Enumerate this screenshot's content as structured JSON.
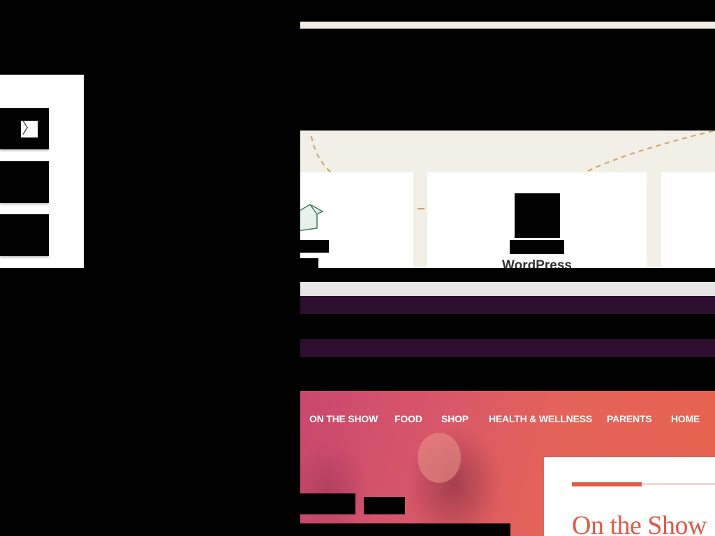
{
  "left_panel": {
    "chevron_glyph": "〉"
  },
  "cards": {
    "middle_title": "WordPress"
  },
  "hero": {
    "nav": [
      "ON THE SHOW",
      "FOOD",
      "SHOP",
      "HEALTH & WELLNESS",
      "PARENTS",
      "HOME"
    ],
    "card_title": "On the Show"
  },
  "colors": {
    "accent": "#e05a48",
    "purple_band": "#2e0e2f",
    "beige": "#f2efe6"
  },
  "icons": [
    "chevron-right-icon",
    "house-icon"
  ]
}
